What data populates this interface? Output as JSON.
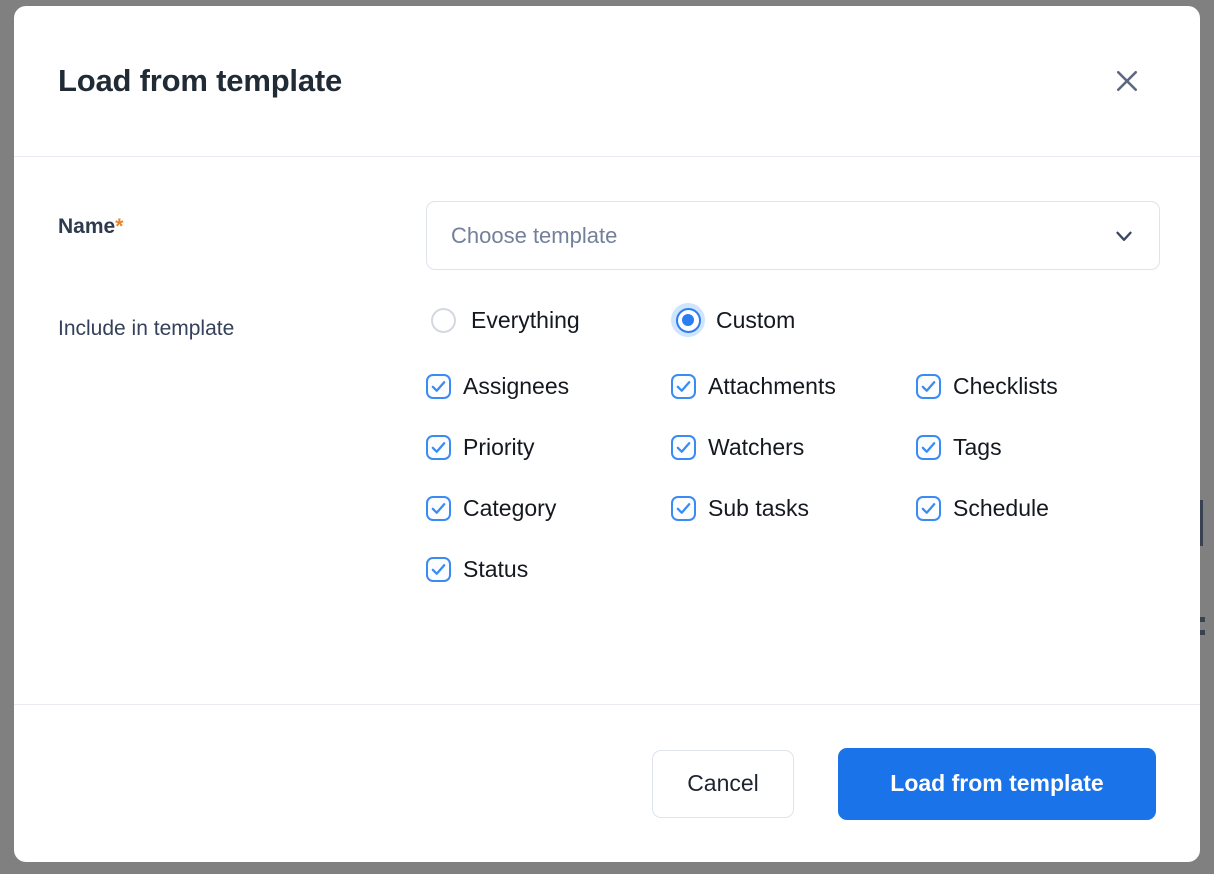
{
  "dialog": {
    "title": "Load from template",
    "close_icon": "close-icon"
  },
  "form": {
    "name_label": "Name",
    "required_marker": "*",
    "template_select": {
      "placeholder": "Choose template",
      "value": "",
      "chevron_icon": "chevron-down-icon"
    },
    "include_label": "Include in template",
    "scope_options": [
      {
        "label": "Everything",
        "selected": false
      },
      {
        "label": "Custom",
        "selected": true
      }
    ],
    "include_items": [
      {
        "label": "Assignees",
        "checked": true
      },
      {
        "label": "Attachments",
        "checked": true
      },
      {
        "label": "Checklists",
        "checked": true
      },
      {
        "label": "Priority",
        "checked": true
      },
      {
        "label": "Watchers",
        "checked": true
      },
      {
        "label": "Tags",
        "checked": true
      },
      {
        "label": "Category",
        "checked": true
      },
      {
        "label": "Sub tasks",
        "checked": true
      },
      {
        "label": "Schedule",
        "checked": true
      },
      {
        "label": "Status",
        "checked": true
      }
    ]
  },
  "footer": {
    "cancel_label": "Cancel",
    "submit_label": "Load from template"
  },
  "colors": {
    "accent_blue": "#1a73e8",
    "checkbox_blue": "#3b8bf4",
    "radio_halo": "#cfe4fd",
    "required_orange": "#e8842a",
    "title_navy": "#212b36",
    "backdrop_gray": "#808080"
  }
}
